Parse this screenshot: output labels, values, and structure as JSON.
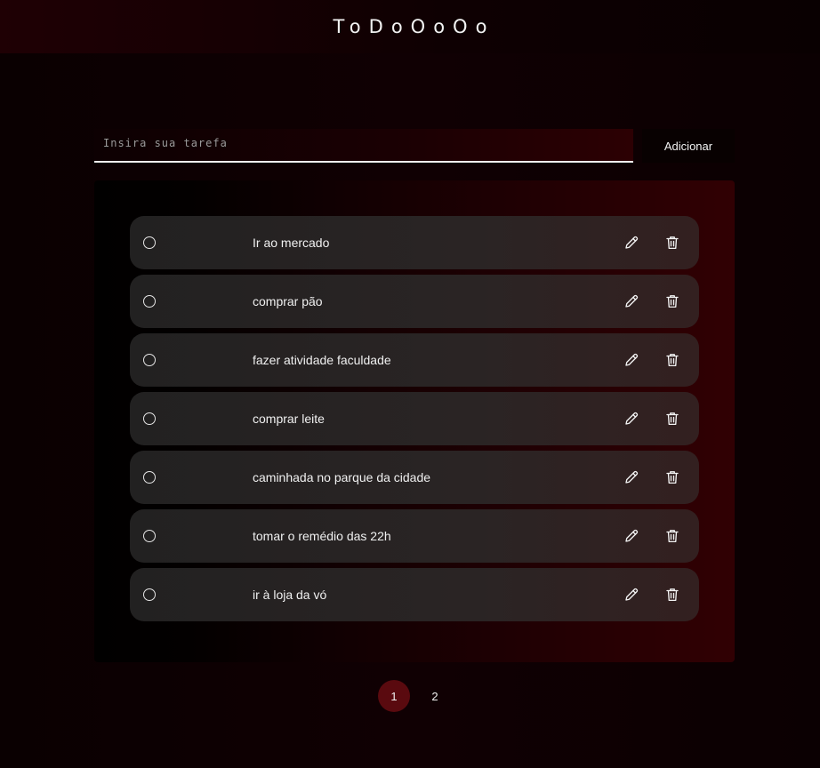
{
  "header": {
    "brand": "ToDoOoOo"
  },
  "form": {
    "placeholder": "Insira sua tarefa",
    "value": "",
    "add_label": "Adicionar"
  },
  "tasks": [
    {
      "text": "Ir ao mercado",
      "done": false
    },
    {
      "text": "comprar pão",
      "done": false
    },
    {
      "text": "fazer atividade faculdade",
      "done": false
    },
    {
      "text": "comprar leite",
      "done": false
    },
    {
      "text": "caminhada no parque da cidade",
      "done": false
    },
    {
      "text": "tomar o remédio das 22h",
      "done": false
    },
    {
      "text": "ir à loja da vó",
      "done": false
    }
  ],
  "icons": {
    "check": "circle-icon",
    "edit": "pencil-icon",
    "delete": "trash-icon"
  },
  "pagination": {
    "pages": [
      "1",
      "2"
    ],
    "current": "1"
  },
  "colors": {
    "accent": "#5a0a0f",
    "background": "#0d0002",
    "task_bg": "#262323"
  }
}
